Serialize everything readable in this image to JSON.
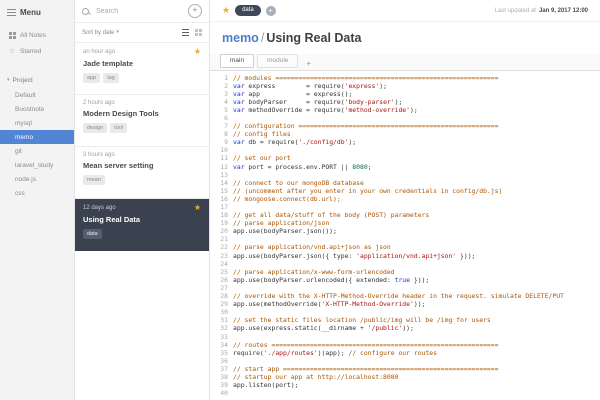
{
  "icons": {
    "star_filled": "★",
    "star_outline": "☆",
    "caret_down": "▾",
    "plus": "+"
  },
  "colors": {
    "accent_blue": "#5286d5",
    "star_orange": "#f5a925",
    "selected_note_bg": "#3a4250",
    "tag_dark": "#414859"
  },
  "sidebar": {
    "menu_label": "Menu",
    "items": [
      {
        "label": "All Notes"
      },
      {
        "label": "Starred"
      }
    ],
    "section_label": "Project",
    "folders": [
      "Default",
      "Boostnote",
      "mysql",
      "memo",
      "git",
      "laravel_study",
      "node.js",
      "css"
    ],
    "selected_folder": "memo"
  },
  "note_list": {
    "search_placeholder": "Search",
    "sort_label": "Sort by date",
    "notes": [
      {
        "time": "an hour ago",
        "title": "Jade template",
        "tags": [
          "app",
          "tag"
        ],
        "starred": true,
        "selected": false
      },
      {
        "time": "2 hours ago",
        "title": "Modern Design Tools",
        "tags": [
          "design",
          "tool"
        ],
        "starred": false,
        "selected": false
      },
      {
        "time": "3 hours ago",
        "title": "Mean server setting",
        "tags": [
          "mean"
        ],
        "starred": false,
        "selected": false
      },
      {
        "time": "12 days ago",
        "title": "Using Real Data",
        "tags": [
          "data"
        ],
        "starred": true,
        "selected": true
      }
    ]
  },
  "detail": {
    "tag": "data",
    "last_updated_label": "Last updated at",
    "last_updated_value": "Jan 9, 2017 12:00",
    "breadcrumb_folder": "memo",
    "breadcrumb_sep": "/",
    "title": "Using Real Data",
    "tabs": [
      "main",
      "module"
    ]
  },
  "editor": {
    "lines": [
      "// modules ==========================================================",
      "var express        = require('express');",
      "var app            = express();",
      "var bodyParser     = require('body-parser');",
      "var methodOverride = require('method-override');",
      "",
      "// configuration ====================================================",
      "// config files",
      "var db = require('./config/db');",
      "",
      "// set our port",
      "var port = process.env.PORT || 8080;",
      "",
      "// connect to our mongoDB database",
      "// (uncomment after you enter in your own credentials in config/db.js)",
      "// mongoose.connect(db.url);",
      "",
      "// get all data/stuff of the body (POST) parameters",
      "// parse application/json",
      "app.use(bodyParser.json());",
      "",
      "// parse application/vnd.api+json as json",
      "app.use(bodyParser.json({ type: 'application/vnd.api+json' }));",
      "",
      "// parse application/x-www-form-urlencoded",
      "app.use(bodyParser.urlencoded({ extended: true }));",
      "",
      "// override with the X-HTTP-Method-Override header in the request. simulate DELETE/PUT",
      "app.use(methodOverride('X-HTTP-Method-Override'));",
      "",
      "// set the static files location /public/img will be /img for users",
      "app.use(express.static(__dirname + '/public'));",
      "",
      "// routes ===========================================================",
      "require('./app/routes')(app); // configure our routes",
      "",
      "// start app ========================================================",
      "// startup our app at http://localhost:8080",
      "app.listen(port);",
      ""
    ]
  }
}
